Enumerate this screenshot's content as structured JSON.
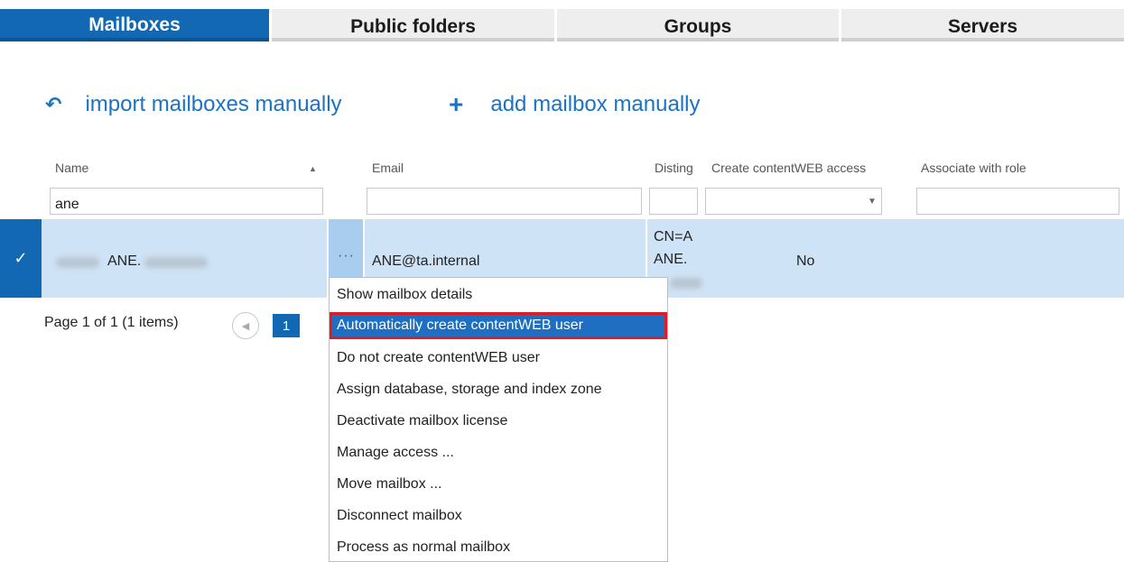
{
  "tabs": [
    {
      "label": "Mailboxes",
      "active": true
    },
    {
      "label": "Public folders",
      "active": false
    },
    {
      "label": "Groups",
      "active": false
    },
    {
      "label": "Servers",
      "active": false
    }
  ],
  "actions": {
    "import_label": "import mailboxes manually",
    "import_icon": "undo-arrow-icon",
    "add_label": "add mailbox manually",
    "add_icon": "plus-icon"
  },
  "table": {
    "columns": [
      "Name",
      "Email",
      "Disting",
      "Create contentWEB access",
      "Associate with role"
    ],
    "filter_name_value": "ane",
    "row": {
      "name": "ANE.",
      "email": "ANE@ta.internal",
      "dn_line1": "CN=A",
      "dn_line2": "ANE.",
      "create_access": "No",
      "actions_label": "···"
    }
  },
  "pager": {
    "text": "Page 1 of 1 (1 items)",
    "current_page": "1"
  },
  "context_menu": [
    "Show mailbox details",
    "Automatically create contentWEB user",
    "Do not create contentWEB user",
    "Assign database, storage and index zone",
    "Deactivate mailbox license",
    "Manage access ...",
    "Move mailbox ...",
    "Disconnect mailbox",
    "Process as normal mailbox"
  ],
  "colors": {
    "accent": "#1268b3",
    "link": "#1a73c4",
    "selected_row": "#cfe3f6",
    "highlight_border": "#e01b24"
  }
}
